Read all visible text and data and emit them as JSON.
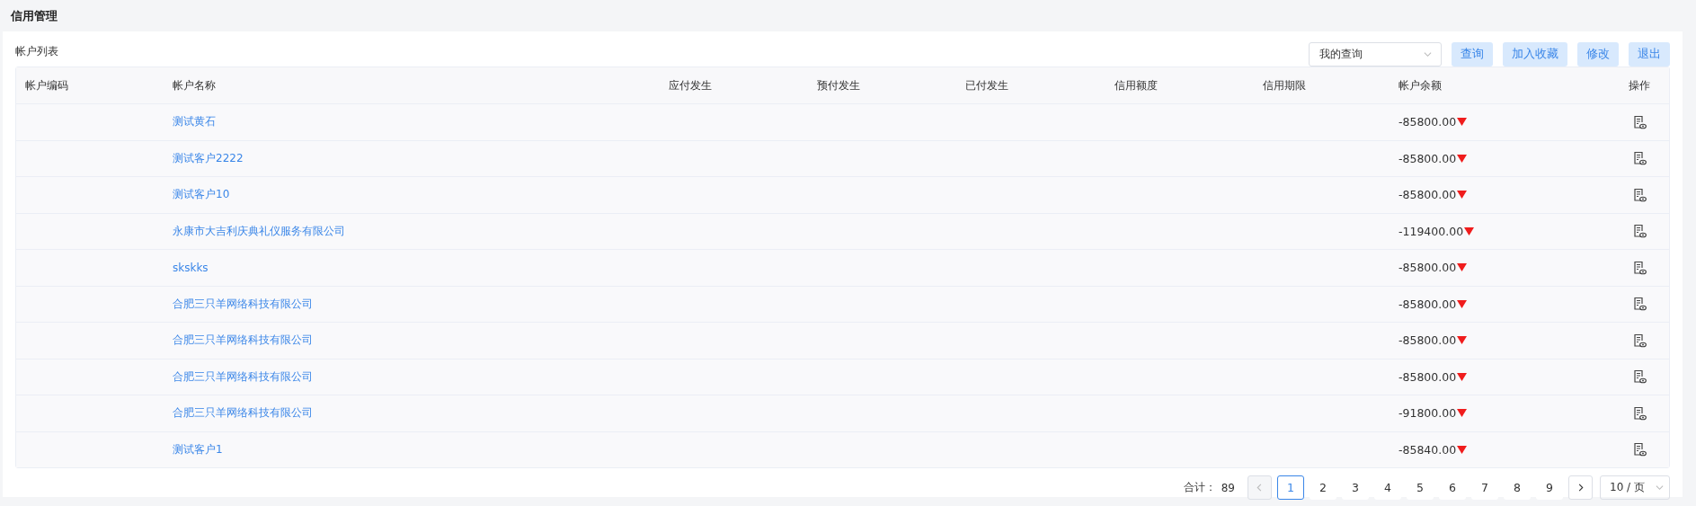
{
  "page_title": "信用管理",
  "panel_title": "帐户列表",
  "toolbar": {
    "query_select": {
      "value": "我的查询"
    },
    "buttons": [
      "查询",
      "加入收藏",
      "修改",
      "退出"
    ]
  },
  "table": {
    "columns": [
      "帐户编码",
      "帐户名称",
      "应付发生",
      "预付发生",
      "已付发生",
      "信用额度",
      "信用期限",
      "帐户余额",
      "操作"
    ],
    "rows": [
      {
        "name": "测试黄石",
        "balance": "-85800.00"
      },
      {
        "name": "测试客户2222",
        "balance": "-85800.00"
      },
      {
        "name": "测试客户10",
        "balance": "-85800.00"
      },
      {
        "name": "永康市大吉利庆典礼仪服务有限公司",
        "balance": "-119400.00"
      },
      {
        "name": "skskks",
        "balance": "-85800.00"
      },
      {
        "name": "合肥三只羊网络科技有限公司",
        "balance": "-85800.00"
      },
      {
        "name": "合肥三只羊网络科技有限公司",
        "balance": "-85800.00"
      },
      {
        "name": "合肥三只羊网络科技有限公司",
        "balance": "-85800.00"
      },
      {
        "name": "合肥三只羊网络科技有限公司",
        "balance": "-91800.00"
      },
      {
        "name": "测试客户1",
        "balance": "-85840.00"
      }
    ]
  },
  "pagination": {
    "total_label": "合计：",
    "total": "89",
    "pages": [
      {
        "label": "1",
        "selected": true
      },
      {
        "label": "2",
        "selected": false
      },
      {
        "label": "3",
        "selected": false
      },
      {
        "label": "4",
        "selected": false
      },
      {
        "label": "5",
        "selected": false
      },
      {
        "label": "6",
        "selected": false
      },
      {
        "label": "7",
        "selected": false
      },
      {
        "label": "8",
        "selected": false
      },
      {
        "label": "9",
        "selected": false
      }
    ],
    "page_size": "10 / 页"
  }
}
